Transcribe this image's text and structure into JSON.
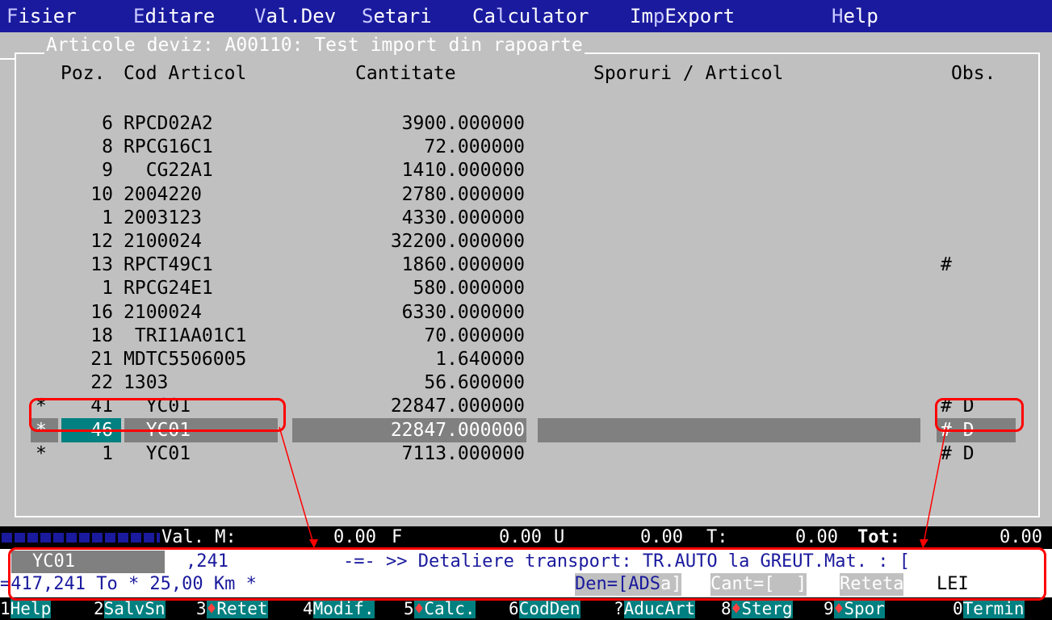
{
  "menu": [
    {
      "hot": "F",
      "rest": "isier"
    },
    {
      "hot": "E",
      "rest": "ditare"
    },
    {
      "hot": "V",
      "rest": "al.Dev"
    },
    {
      "hot": "S",
      "rest": "etari"
    },
    {
      "pre": "Ca",
      "hot": "l",
      "rest": "culator"
    },
    {
      "pre": "Im",
      "hot": "p",
      "rest": "Export"
    },
    {
      "hot": "H",
      "rest": "elp"
    }
  ],
  "window": {
    "title": "Articole deviz: A00110: Test import din rapoarte"
  },
  "columns": {
    "poz": "Poz.",
    "cod": "Cod Articol",
    "cant": "Cantitate",
    "spor": "Sporuri / Articol",
    "obs": "Obs."
  },
  "rows": [
    {
      "mark": "",
      "poz": "6",
      "cod": "RPCD02A2",
      "cant": "3900.000000",
      "obs": ""
    },
    {
      "mark": "",
      "poz": "8",
      "cod": "RPCG16C1",
      "cant": "72.000000",
      "obs": ""
    },
    {
      "mark": "",
      "poz": "9",
      "cod": "  CG22A1",
      "cant": "1410.000000",
      "obs": ""
    },
    {
      "mark": "",
      "poz": "10",
      "cod": "2004220",
      "cant": "2780.000000",
      "obs": ""
    },
    {
      "mark": "",
      "poz": "1",
      "cod": "2003123",
      "cant": "4330.000000",
      "obs": ""
    },
    {
      "mark": "",
      "poz": "12",
      "cod": "2100024",
      "cant": "32200.000000",
      "obs": ""
    },
    {
      "mark": "",
      "poz": "13",
      "cod": "RPCT49C1",
      "cant": "1860.000000",
      "obs": "#"
    },
    {
      "mark": "",
      "poz": "1",
      "cod": "RPCG24E1",
      "cant": "580.000000",
      "obs": ""
    },
    {
      "mark": "",
      "poz": "16",
      "cod": "2100024",
      "cant": "6330.000000",
      "obs": ""
    },
    {
      "mark": "",
      "poz": "18",
      "cod": " TRI1AA01C1",
      "cant": "70.000000",
      "obs": ""
    },
    {
      "mark": "",
      "poz": "21",
      "cod": "MDTC5506005",
      "cant": "1.640000",
      "obs": ""
    },
    {
      "mark": "",
      "poz": "22",
      "cod": "1303",
      "cant": "56.600000",
      "obs": ""
    },
    {
      "mark": "*",
      "poz": "41",
      "cod": "  YC01",
      "cant": "22847.000000",
      "obs": "# D"
    },
    {
      "mark": "*",
      "poz": "46",
      "cod": "  YC01",
      "cant": "22847.000000",
      "obs": "# D"
    },
    {
      "mark": "*",
      "poz": "1",
      "cod": "  YC01",
      "cant": "7113.000000",
      "obs": "# D"
    }
  ],
  "selected_row": 13,
  "status": {
    "val_m": "Val. M:",
    "v1": "0.00",
    "f": "F",
    "v2": "0.00",
    "u": "U",
    "v3": "0.00",
    "t": "T:",
    "v4": "0.00",
    "tot": "Tot:",
    "v5": "0.00"
  },
  "info": {
    "code": "YC01",
    "num": ",241",
    "message": "-=- >> Detaliere transport: TR.AUTO la GREUT.Mat. : [",
    "line2": "=417,241 To * 25,00 Km *",
    "den_label": "Den=[ADS",
    "den_tail": "a]",
    "cant_label": "Cant=[  ]",
    "reteta": "Reteta",
    "lei": "LEI"
  },
  "fkeys": [
    {
      "n": "1",
      "l": "Help",
      "d": ""
    },
    {
      "n": "2",
      "l": "SalvSn",
      "d": ""
    },
    {
      "n": "3",
      "l": "Retet",
      "d": "♦"
    },
    {
      "n": "4",
      "l": "Modif.",
      "d": ""
    },
    {
      "n": "5",
      "l": "Calc.",
      "d": "♦"
    },
    {
      "n": "6",
      "l": "CodDen",
      "d": ""
    },
    {
      "n": "?",
      "l": "AducArt",
      "d": ""
    },
    {
      "n": "8",
      "l": "Sterg",
      "d": "♦"
    },
    {
      "n": "9",
      "l": "Spor",
      "d": "♦"
    },
    {
      "n": "0",
      "l": "Termin",
      "d": ""
    }
  ],
  "colors": {
    "menu_bg": "#1a1a9e",
    "panel_bg": "#c0c0c0",
    "highlight": "#808080",
    "accent": "#008080",
    "annotation": "#ff0000"
  }
}
